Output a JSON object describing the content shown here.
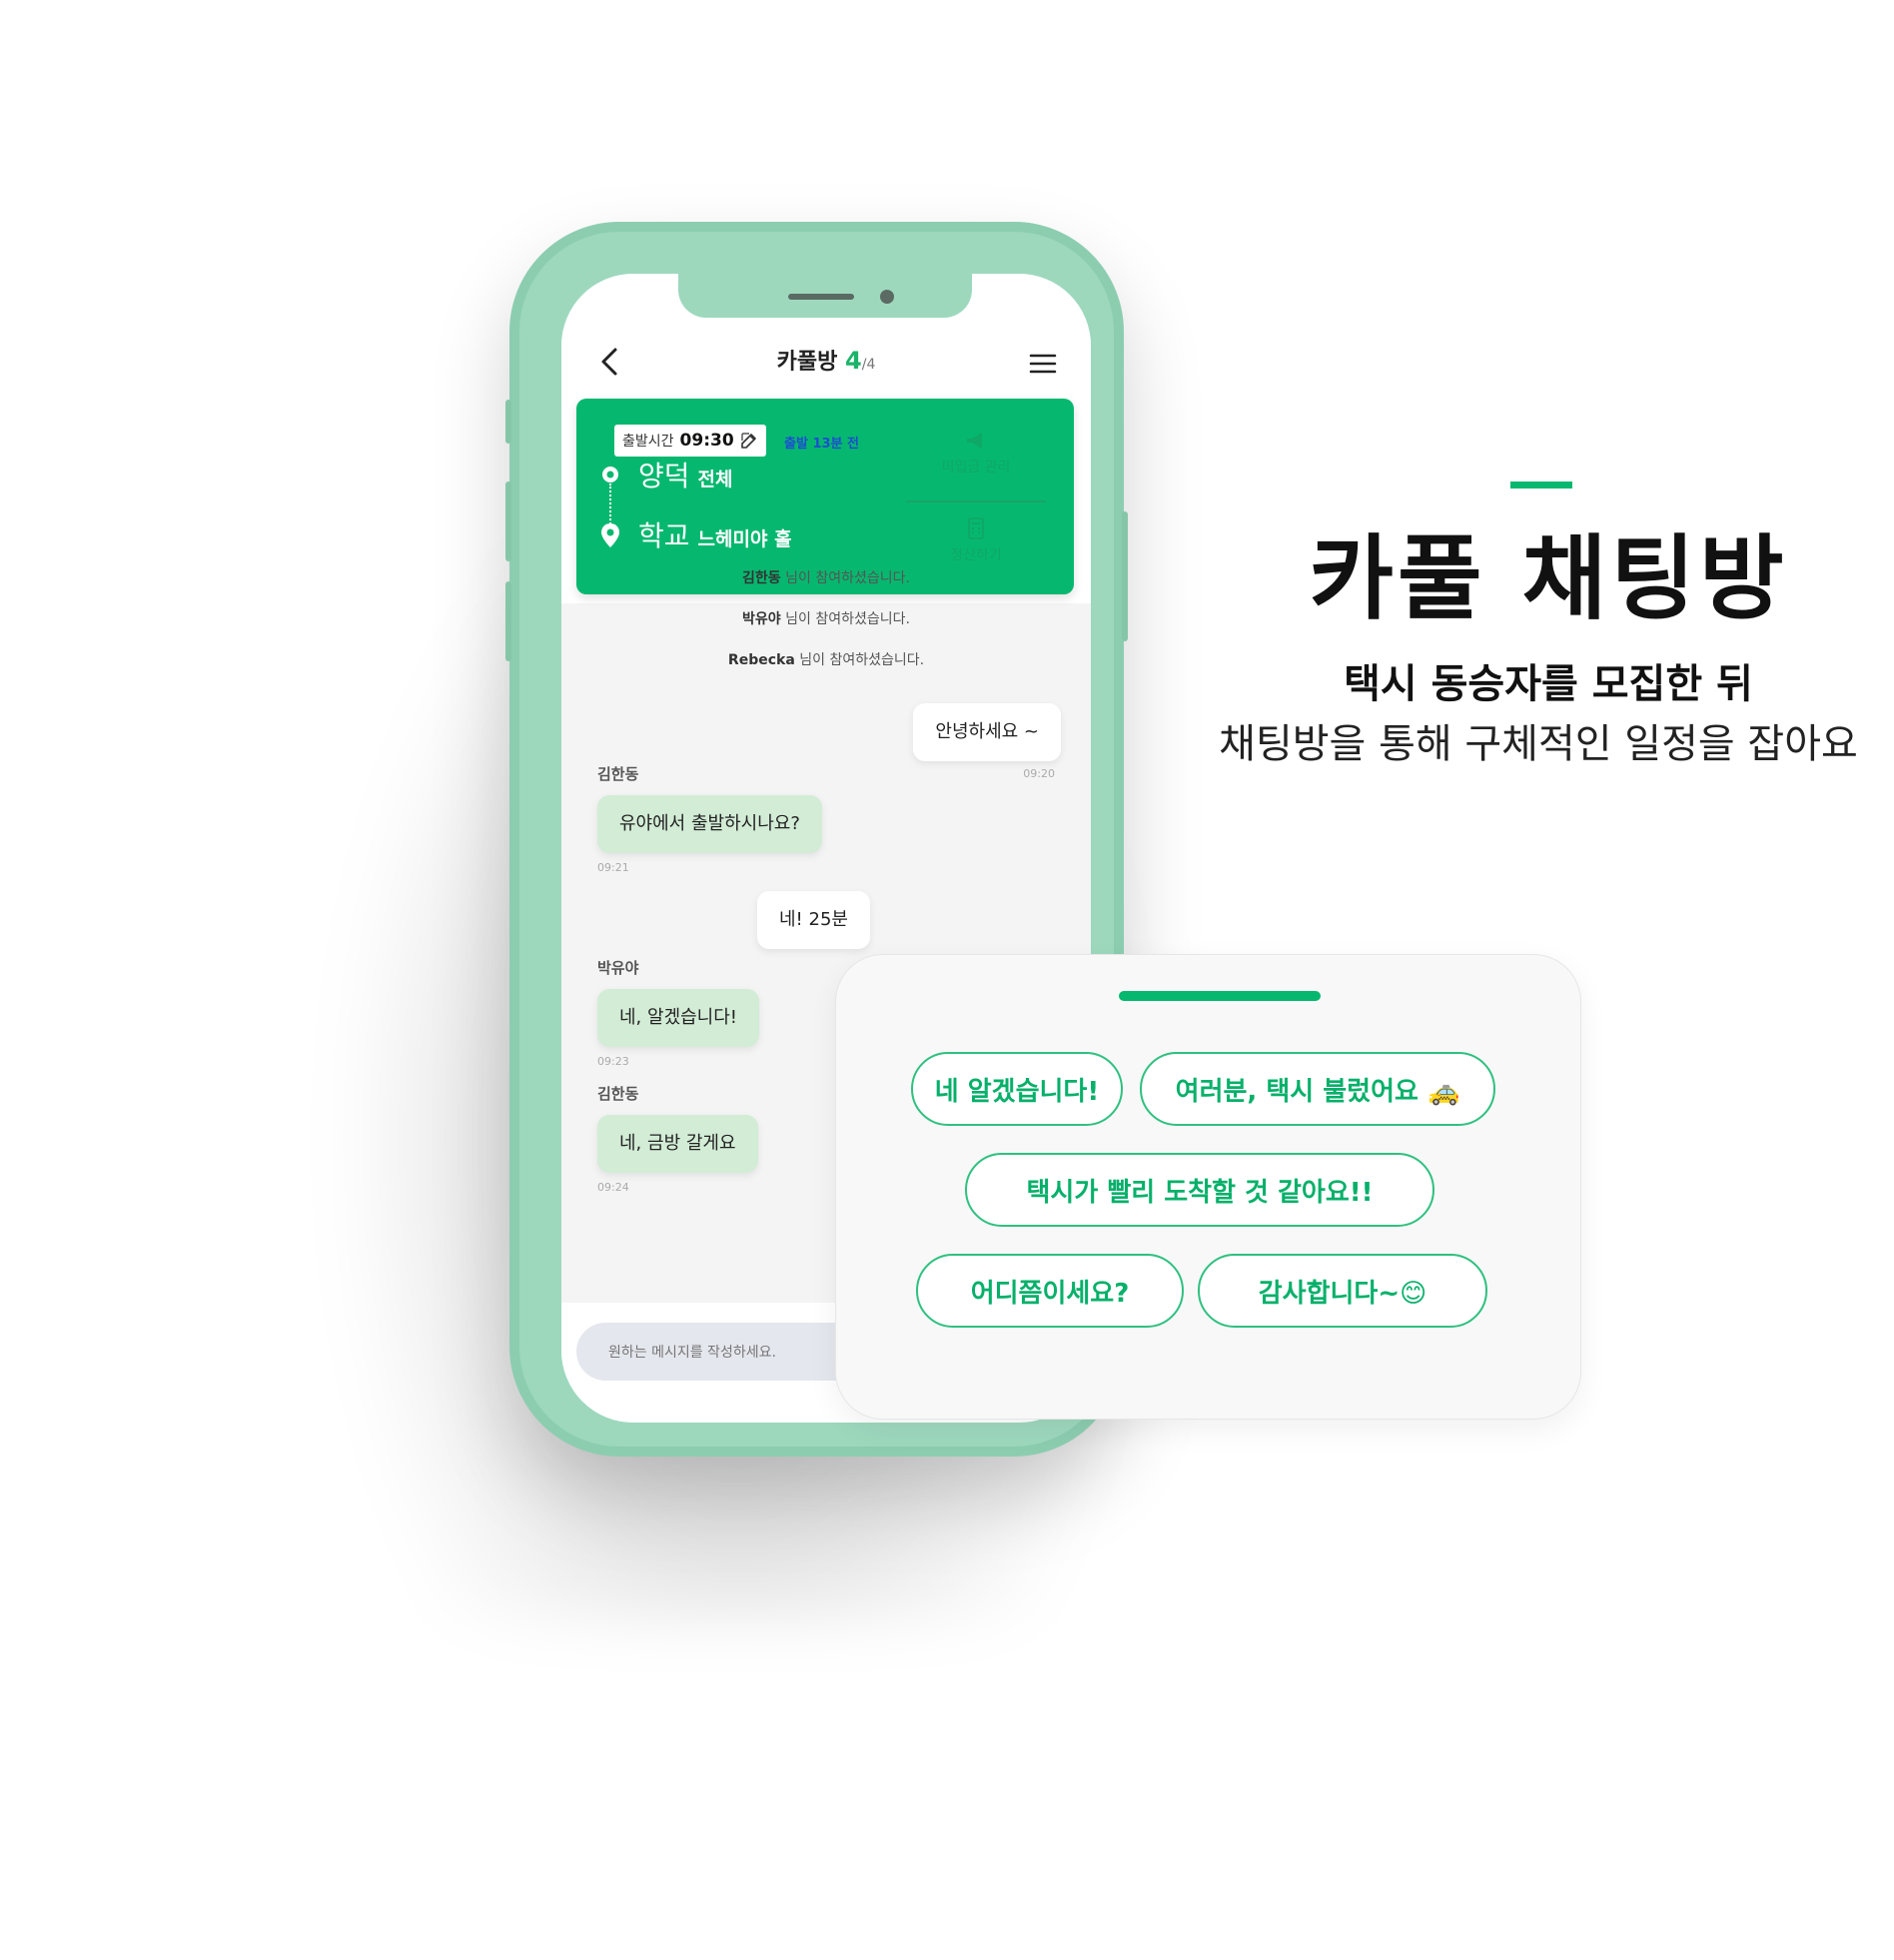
{
  "nav": {
    "title": "카풀방",
    "count": "4",
    "total": "/4"
  },
  "trip": {
    "time_label": "출발시간",
    "time_value": "09:30",
    "countdown": "출발 13분 전",
    "origin": "양덕",
    "origin_sub": "전체",
    "destination": "학교",
    "destination_sub": "느헤미야 홀",
    "action_unpaid": "미입금 관리",
    "action_settle": "정산하기"
  },
  "system_messages": [
    {
      "name": "김한동",
      "text": " 님이 참여하셨습니다."
    },
    {
      "name": "박유야",
      "text": " 님이 참여하셨습니다."
    },
    {
      "name": "Rebecka",
      "text": " 님이 참여하셨습니다."
    }
  ],
  "messages": [
    {
      "from": "me",
      "text": "안녕하세요 ~",
      "time": "09:20"
    },
    {
      "from": "김한동",
      "text": "유야에서 출발하시나요?",
      "time": "09:21"
    },
    {
      "from": "me",
      "text": "네! 25분"
    },
    {
      "from": "박유야",
      "text": "네, 알겠습니다!",
      "time": "09:23"
    },
    {
      "from": "김한동",
      "text": "네, 금방 갈게요",
      "time": "09:24"
    }
  ],
  "input": {
    "placeholder": "원하는 메시지를 작성하세요."
  },
  "quick_replies": [
    "네 알겠습니다!",
    "여러분, 택시 불렀어요 🚕",
    "택시가 빨리 도착할 것 같아요!!",
    "어디쯤이세요?",
    "감사합니다~😊"
  ],
  "promo": {
    "headline": "카풀 채팅방",
    "line1": "택시 동승자를 모집한 뒤",
    "line2": "채팅방을 통해 구체적인 일정을 잡아요"
  },
  "colors": {
    "brand": "#06b86f",
    "phone": "#9dd8bd",
    "bubble_other": "#d3ecd6"
  }
}
